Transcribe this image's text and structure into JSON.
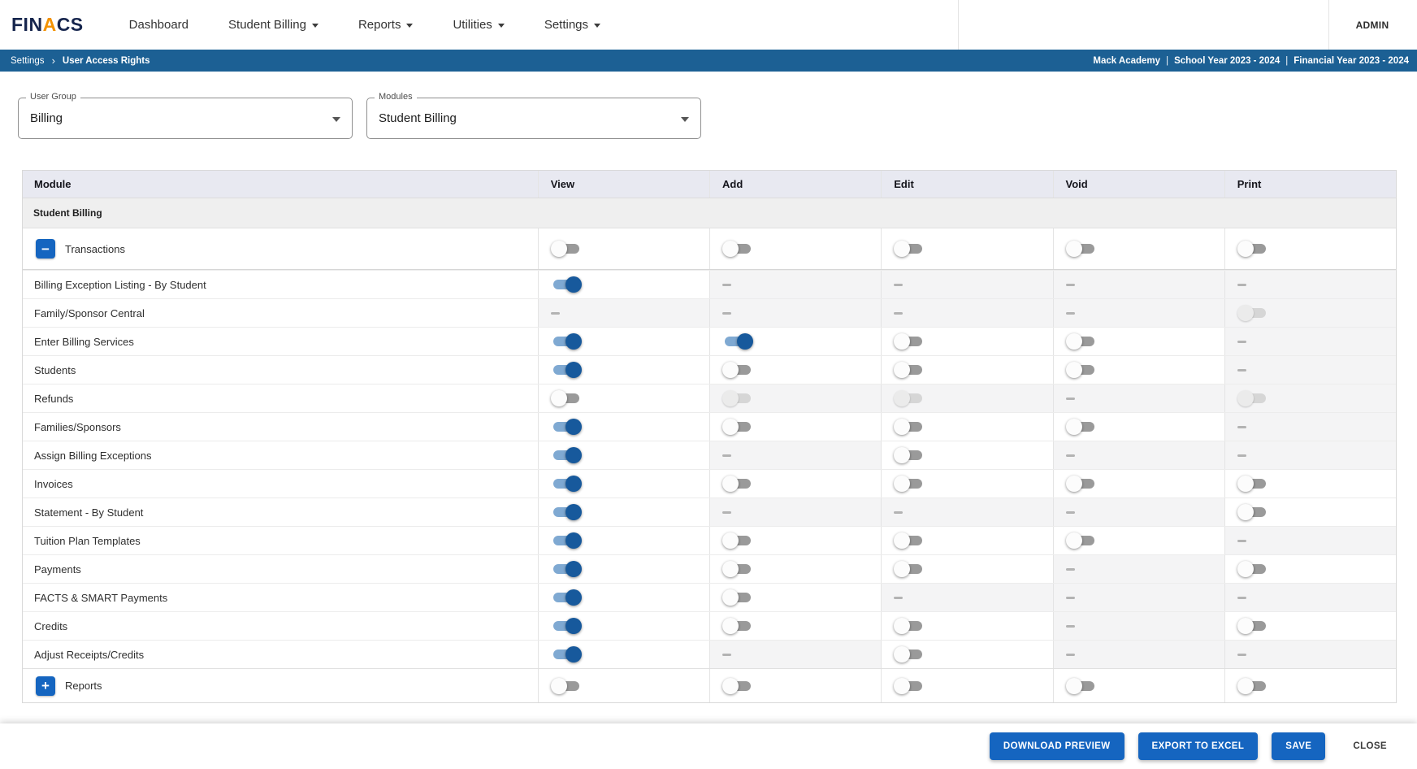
{
  "app": {
    "logo": {
      "fin": "FIN",
      "a": "A",
      "cs": "CS"
    },
    "nav_items": [
      {
        "label": "Dashboard",
        "has_menu": false
      },
      {
        "label": "Student Billing",
        "has_menu": true
      },
      {
        "label": "Reports",
        "has_menu": true
      },
      {
        "label": "Utilities",
        "has_menu": true
      },
      {
        "label": "Settings",
        "has_menu": true
      }
    ],
    "user_label": "ADMIN"
  },
  "breadcrumb": {
    "path": [
      "Settings",
      "User Access Rights"
    ],
    "context": [
      "Mack Academy",
      "School Year 2023 - 2024",
      "Financial Year 2023 - 2024"
    ],
    "separator": "|"
  },
  "filters": {
    "user_group": {
      "label": "User Group",
      "value": "Billing"
    },
    "modules": {
      "label": "Modules",
      "value": "Student Billing"
    }
  },
  "table": {
    "columns": [
      "Module",
      "View",
      "Add",
      "Edit",
      "Void",
      "Print"
    ],
    "group_header": "Student Billing",
    "sections": [
      {
        "name": "Transactions",
        "expanded": true,
        "expander_glyph": "−",
        "toggles": [
          "off",
          "off",
          "off",
          "off",
          "off"
        ],
        "rows": [
          {
            "name": "Billing Exception Listing - By Student",
            "toggles": [
              "on",
              "dash",
              "dash",
              "dash",
              "dash"
            ]
          },
          {
            "name": "Family/Sponsor Central",
            "toggles": [
              "dash",
              "dash",
              "dash",
              "dash",
              "off-muted"
            ]
          },
          {
            "name": "Enter Billing Services",
            "toggles": [
              "on",
              "on",
              "off",
              "off",
              "dash"
            ]
          },
          {
            "name": "Students",
            "toggles": [
              "on",
              "off",
              "off",
              "off",
              "dash"
            ]
          },
          {
            "name": "Refunds",
            "toggles": [
              "off",
              "off-muted",
              "off-muted",
              "dash",
              "off-muted"
            ]
          },
          {
            "name": "Families/Sponsors",
            "toggles": [
              "on",
              "off",
              "off",
              "off",
              "dash"
            ]
          },
          {
            "name": "Assign Billing Exceptions",
            "toggles": [
              "on",
              "dash",
              "off",
              "dash",
              "dash"
            ]
          },
          {
            "name": "Invoices",
            "toggles": [
              "on",
              "off",
              "off",
              "off",
              "off"
            ]
          },
          {
            "name": "Statement - By Student",
            "toggles": [
              "on",
              "dash",
              "dash",
              "dash",
              "off"
            ]
          },
          {
            "name": "Tuition Plan Templates",
            "toggles": [
              "on",
              "off",
              "off",
              "off",
              "dash"
            ]
          },
          {
            "name": "Payments",
            "toggles": [
              "on",
              "off",
              "off",
              "dash",
              "off"
            ]
          },
          {
            "name": "FACTS & SMART Payments",
            "toggles": [
              "on",
              "off",
              "dash",
              "dash",
              "dash"
            ]
          },
          {
            "name": "Credits",
            "toggles": [
              "on",
              "off",
              "off",
              "dash",
              "off"
            ]
          },
          {
            "name": "Adjust Receipts/Credits",
            "toggles": [
              "on",
              "dash",
              "off",
              "dash",
              "dash"
            ]
          }
        ]
      },
      {
        "name": "Reports",
        "expanded": false,
        "expander_glyph": "+",
        "toggles": [
          "off",
          "off",
          "off",
          "off",
          "off"
        ],
        "rows": []
      }
    ]
  },
  "footer": {
    "buttons": [
      {
        "label": "DOWNLOAD PREVIEW",
        "variant": "primary"
      },
      {
        "label": "EXPORT TO EXCEL",
        "variant": "primary"
      },
      {
        "label": "SAVE",
        "variant": "primary"
      },
      {
        "label": "CLOSE",
        "variant": "text"
      }
    ]
  },
  "colors": {
    "accent": "#1565c0",
    "breadcrumb_bar": "#1c6094",
    "header_row_bg": "#e8e9f1",
    "group_row_bg": "#efefef",
    "toggle_on_thumb": "#17599c",
    "logo_navy": "#16254d",
    "logo_orange": "#f39200"
  }
}
